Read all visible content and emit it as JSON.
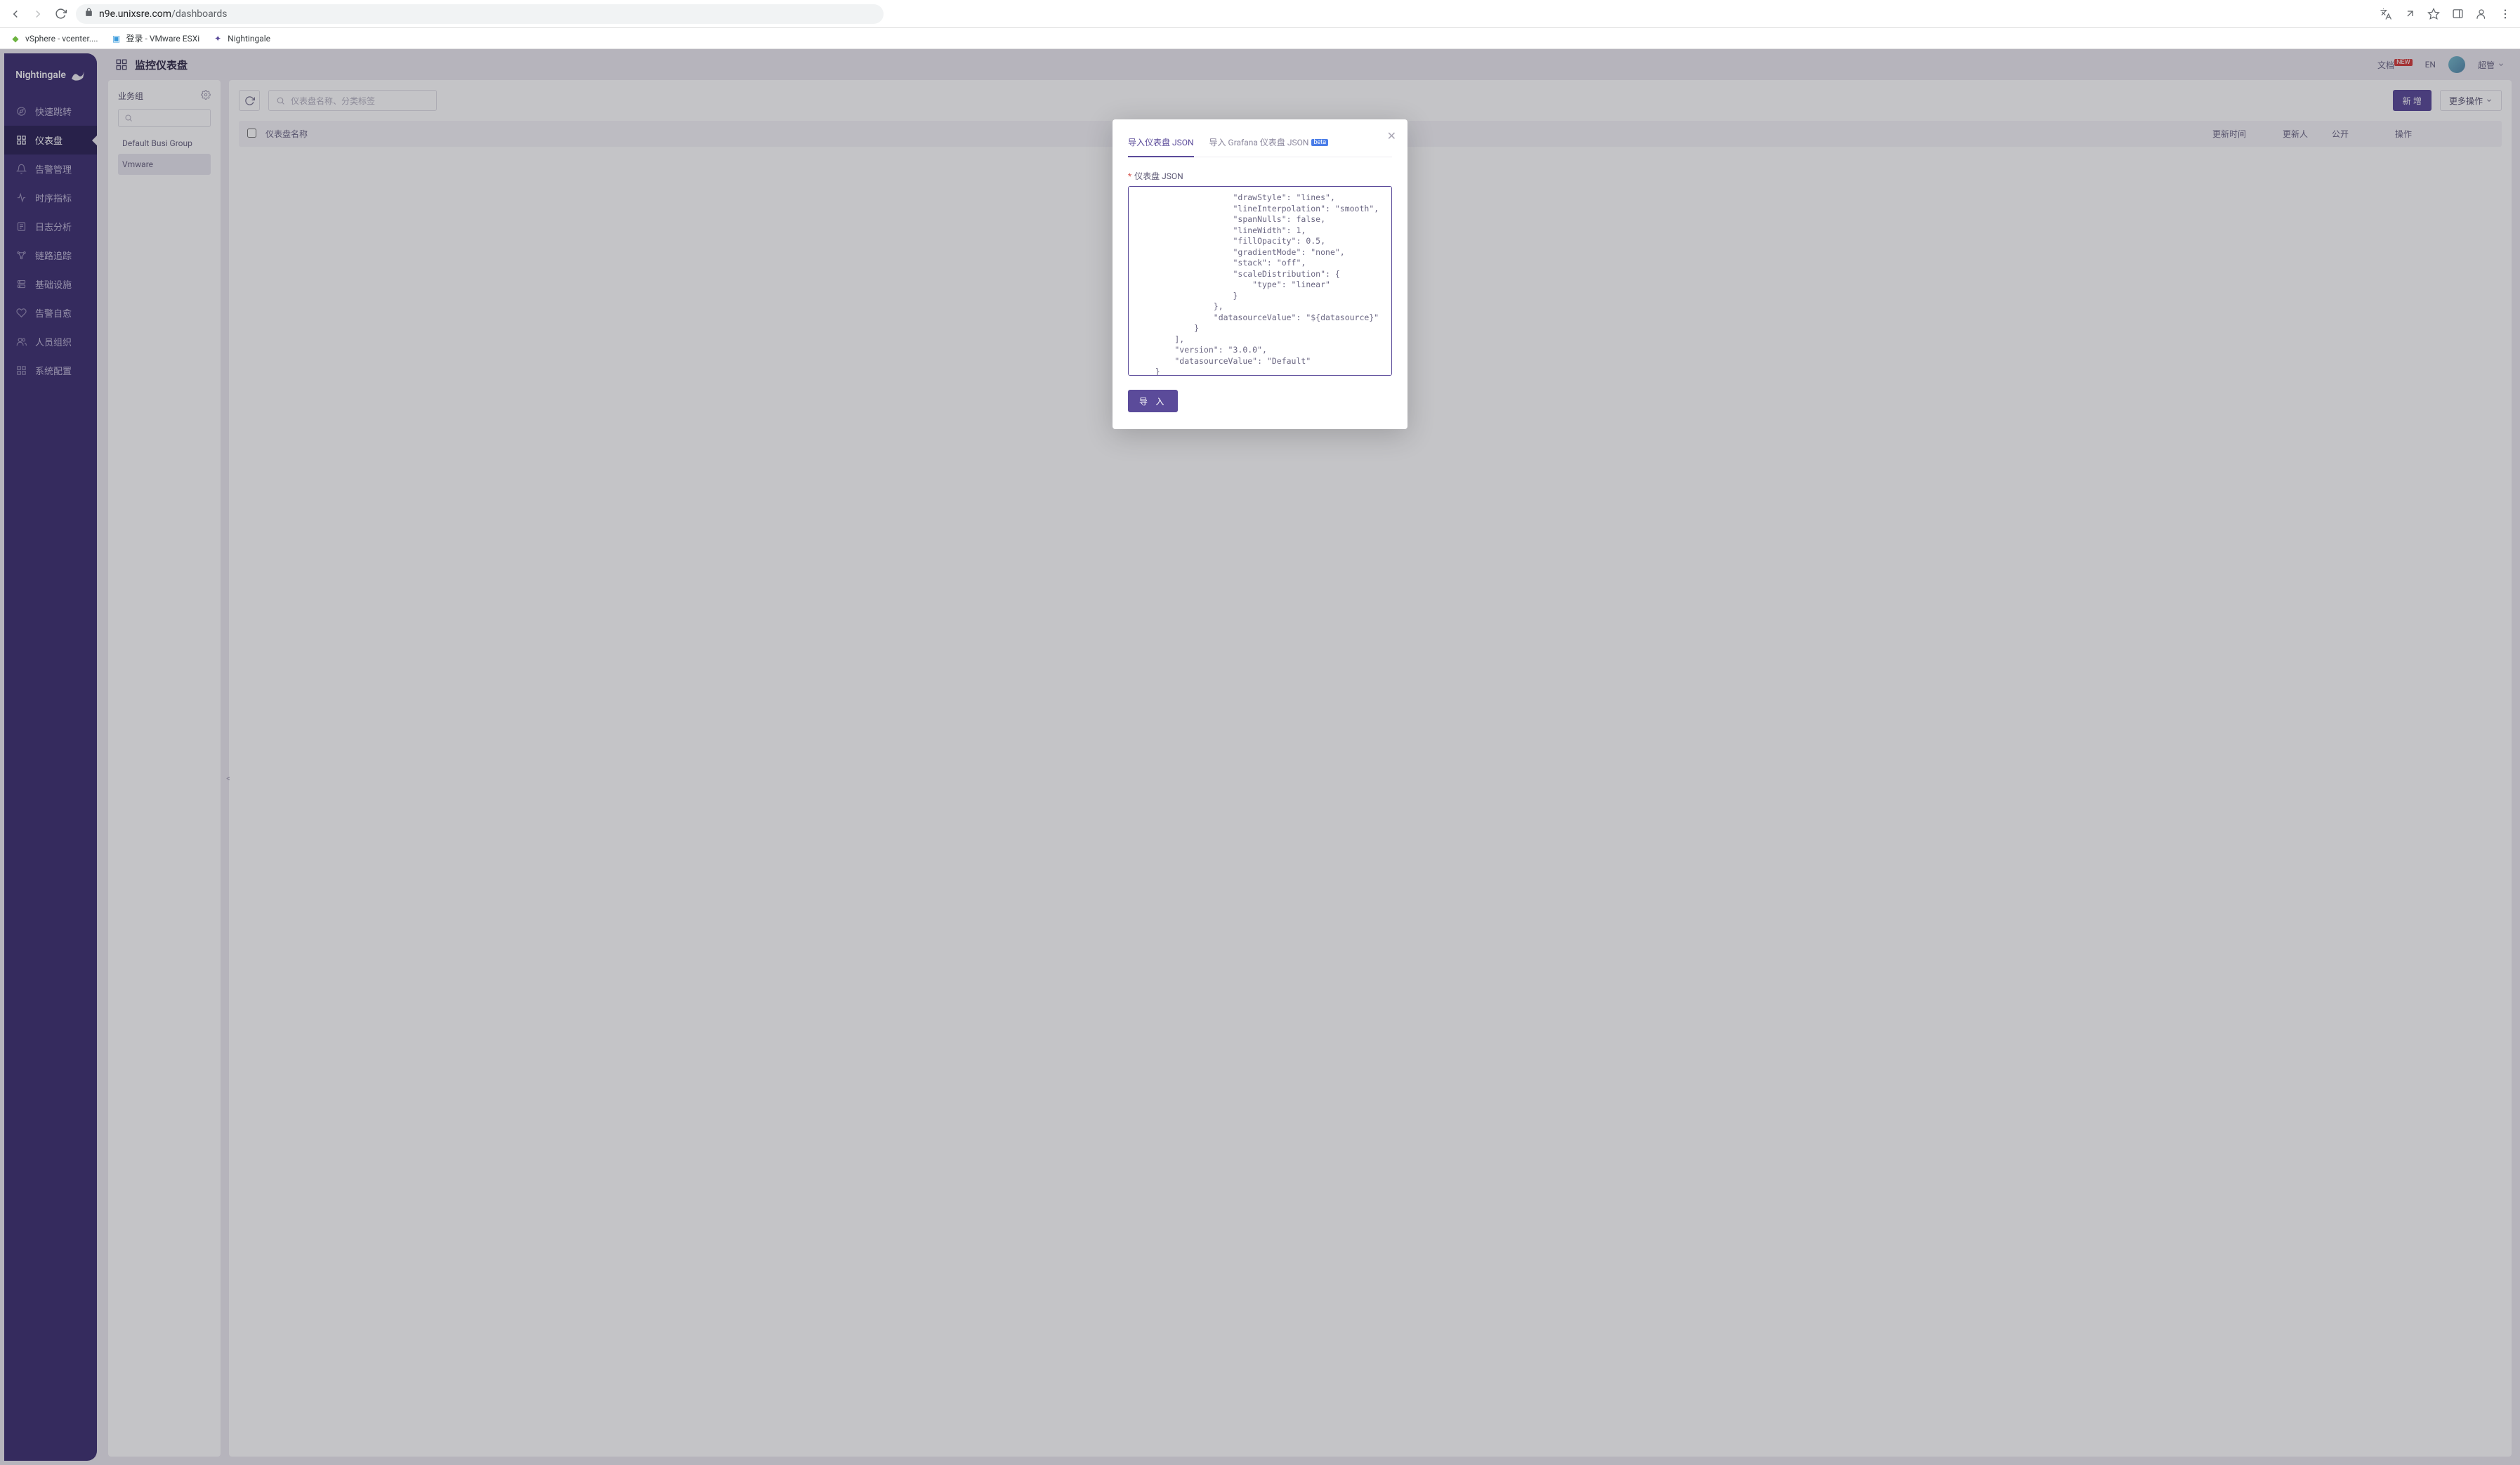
{
  "browser": {
    "url_host": "n9e.unixsre.com",
    "url_path": "/dashboards",
    "bookmarks": [
      {
        "label": "vSphere - vcenter...."
      },
      {
        "label": "登录 - VMware ESXi"
      },
      {
        "label": "Nightingale"
      }
    ]
  },
  "brand": "Nightingale",
  "sidebar": [
    {
      "icon": "compass",
      "label": "快速跳转"
    },
    {
      "icon": "dashboard",
      "label": "仪表盘",
      "active": true
    },
    {
      "icon": "alert",
      "label": "告警管理"
    },
    {
      "icon": "metrics",
      "label": "时序指标"
    },
    {
      "icon": "logs",
      "label": "日志分析"
    },
    {
      "icon": "trace",
      "label": "链路追踪"
    },
    {
      "icon": "infra",
      "label": "基础设施"
    },
    {
      "icon": "self-heal",
      "label": "告警自愈"
    },
    {
      "icon": "users",
      "label": "人员组织"
    },
    {
      "icon": "settings",
      "label": "系统配置"
    }
  ],
  "topbar": {
    "title": "监控仪表盘",
    "docs_label": "文档",
    "docs_badge": "NEW",
    "lang_label": "EN",
    "user_name": "超管"
  },
  "biz_panel": {
    "header": "业务组",
    "items": [
      {
        "label": "Default Busi Group",
        "selected": false
      },
      {
        "label": "Vmware",
        "selected": true
      }
    ]
  },
  "main_panel": {
    "search_placeholder": "仪表盘名称、分类标签",
    "btn_new": "新 增",
    "btn_more": "更多操作",
    "table_headers": {
      "name": "仪表盘名称",
      "updated_at": "更新时间",
      "updated_by": "更新人",
      "public": "公开",
      "ops": "操作"
    }
  },
  "modal": {
    "tab_json": "导入仪表盘 JSON",
    "tab_grafana": "导入 Grafana 仪表盘 JSON",
    "grafana_badge": "beta",
    "form_label": "仪表盘 JSON",
    "json_text": "                    \"drawStyle\": \"lines\",\n                    \"lineInterpolation\": \"smooth\",\n                    \"spanNulls\": false,\n                    \"lineWidth\": 1,\n                    \"fillOpacity\": 0.5,\n                    \"gradientMode\": \"none\",\n                    \"stack\": \"off\",\n                    \"scaleDistribution\": {\n                        \"type\": \"linear\"\n                    }\n                },\n                \"datasourceValue\": \"${datasource}\"\n            }\n        ],\n        \"version\": \"3.0.0\",\n        \"datasourceValue\": \"Default\"\n    }\n]",
    "btn_import": "导 入"
  }
}
